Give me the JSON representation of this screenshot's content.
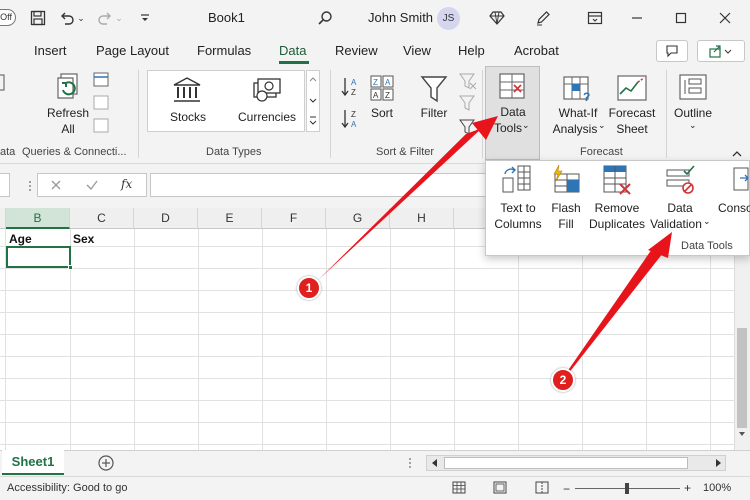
{
  "titlebar": {
    "autosave_label": "Off",
    "title": "Book1",
    "user_name": "John Smith",
    "user_initials": "JS"
  },
  "tabs": [
    "Insert",
    "Page Layout",
    "Formulas",
    "Data",
    "Review",
    "View",
    "Help",
    "Acrobat"
  ],
  "active_tab": "Data",
  "ribbon": {
    "refresh_label": "Refresh",
    "refresh_sub": "All",
    "group_queries": "Queries & Connecti...",
    "stocks_label": "Stocks",
    "currencies_label": "Currencies",
    "group_datatypes": "Data Types",
    "sort_label": "Sort",
    "filter_label": "Filter",
    "group_sortfilter": "Sort & Filter",
    "datatools_label": "Data",
    "datatools_sub": "Tools",
    "whatif_label": "What-If",
    "whatif_sub": "Analysis",
    "forecast_label": "Forecast",
    "forecast_sub": "Sheet",
    "group_forecast": "Forecast",
    "outline_label": "Outline",
    "group_left_fragment": "ata"
  },
  "formula_bar": {
    "fx_label": "fx",
    "value": ""
  },
  "grid": {
    "columns": [
      "B",
      "C",
      "D",
      "E",
      "F",
      "G",
      "H"
    ],
    "cells": {
      "B1": "Age",
      "C1": "Sex"
    }
  },
  "data_tools_panel": {
    "text_to_columns": "Text to",
    "text_to_columns_sub": "Columns",
    "flash_fill": "Flash",
    "flash_fill_sub": "Fill",
    "remove_duplicates": "Remove",
    "remove_duplicates_sub": "Duplicates",
    "data_validation": "Data",
    "data_validation_sub": "Validation",
    "consolidate": "Conso",
    "group_label": "Data Tools"
  },
  "callouts": [
    "1",
    "2"
  ],
  "sheet_tabs": [
    "Sheet1"
  ],
  "status": {
    "accessibility": "Accessibility: Good to go",
    "zoom": "100%"
  },
  "colors": {
    "accent": "#217346",
    "callout": "#e01f1f",
    "arrow": "#e8141b"
  }
}
